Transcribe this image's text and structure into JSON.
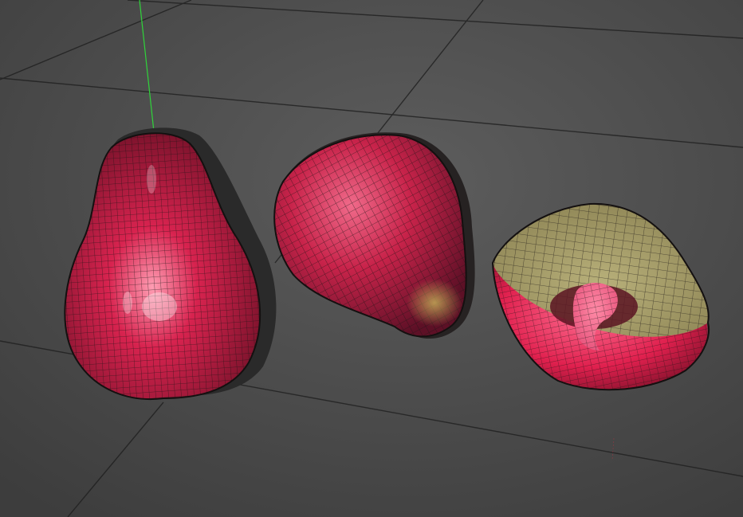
{
  "viewport": {
    "background_top": "#5d5d5d",
    "background_bottom": "#3d3d3d",
    "grid_color": "#1f1f1f",
    "y_axis_color": "#2fd43a",
    "x_axis_color": "#c03040",
    "wire_color": "#1a1414"
  },
  "objects": [
    {
      "name": "rose-apple-upright",
      "base_color": "#d8234f",
      "highlight": "#ff9db3",
      "shadow": "#6d1026",
      "rim_color": "#2a2a2a"
    },
    {
      "name": "rose-apple-tilted",
      "base_color": "#c8234a",
      "highlight": "#f06a8a",
      "shadow": "#5d1026",
      "tip_color": "#c9b45a"
    },
    {
      "name": "rose-apple-halved",
      "base_color": "#e0204e",
      "flesh_color": "#b8b07a",
      "core_color": "#e8567e",
      "cavity_color": "#5a1422"
    }
  ]
}
